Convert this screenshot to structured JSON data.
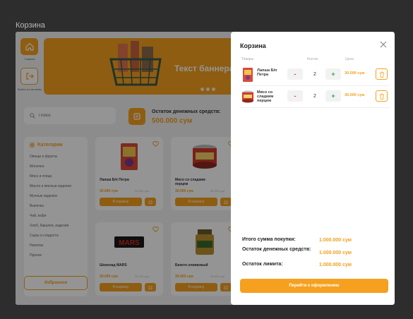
{
  "frame": {
    "title": "Корзина"
  },
  "nav": {
    "home_label": "Главная",
    "logout_label": "Выйти из системы"
  },
  "banner": {
    "title": "Текст баннера"
  },
  "search": {
    "placeholder": "Поиск"
  },
  "balance": {
    "label": "Остаток денежных средств:",
    "value": "500.000 сум"
  },
  "categories": {
    "title": "Категории",
    "items": [
      "Овощи и фрукты",
      "Молочка",
      "Мясо и птица",
      "Масло и мясные изделия",
      "Мучные изделия",
      "Выпечка",
      "Чай, кофе",
      "Хлеб, бакалея, изделия",
      "Сыры и сладости",
      "Напитки",
      "Прочее"
    ],
    "favorites_label": "Избранное"
  },
  "products": [
    {
      "name": "Лапша Б/п Петра",
      "price": "30.000 сум",
      "old_price": "32.000 сум",
      "cart_label": "В корзину",
      "image": "noodle-pack"
    },
    {
      "name": "Мясо со сладким перцем",
      "price": "30.000 сум",
      "old_price": "32.000 сум",
      "cart_label": "В корзину",
      "image": "meat-can"
    },
    {
      "name": "Шоколад MARS",
      "price": "30.000 сум",
      "old_price": "32.000 сум",
      "cart_label": "В корзину",
      "image": "mars-bar"
    },
    {
      "name": "Бекето оливковый",
      "price": "30.000 сум",
      "old_price": "32.000 сум",
      "cart_label": "В корзину",
      "image": "jar"
    }
  ],
  "modal": {
    "title": "Корзина",
    "columns": {
      "product": "Товары",
      "qty": "Кол-во",
      "price": "Цена"
    },
    "items": [
      {
        "name": "Лапша Б/п Петра",
        "minus": "-",
        "qty": "2",
        "plus": "+",
        "price": "30.000 сум",
        "image": "noodle-pack"
      },
      {
        "name": "Мясо со сладким перцем",
        "minus": "-",
        "qty": "2",
        "plus": "+",
        "price": "30.000 сум",
        "image": "meat-can"
      }
    ],
    "summary": {
      "total_label": "Итого сумма покупки:",
      "total_value": "1.000.000 сум",
      "balance_label": "Остаток денежных средств:",
      "balance_value": "1.000.000 сум",
      "limit_label": "Остаток лимита:",
      "limit_value": "1.000.000 сум"
    },
    "checkout_label": "Перейти к оформлению"
  },
  "colors": {
    "accent": "#f5a01e",
    "minus": "#e23a2e",
    "plus": "#2aa33c"
  }
}
